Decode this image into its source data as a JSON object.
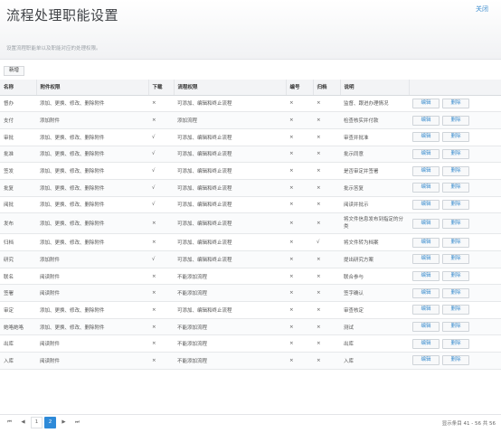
{
  "header": {
    "title": "流程处理职能设置",
    "close_label": "关闭",
    "subtitle": "设置流程职能单以及职能对应的处理权限。"
  },
  "toolbar": {
    "new_label": "新增"
  },
  "table": {
    "columns": [
      "名称",
      "附件权限",
      "下载",
      "流程权限",
      "编号",
      "归档",
      "说明",
      ""
    ],
    "rows": [
      {
        "name": "督办",
        "attach": "添加、更换、修改、删除附件",
        "download": "×",
        "flow": "可添加、编辑和终止流程",
        "number": "×",
        "archive": "×",
        "desc": "监督、跟进办理情况"
      },
      {
        "name": "支付",
        "attach": "添加附件",
        "download": "×",
        "flow": "添加流程",
        "number": "×",
        "archive": "×",
        "desc": "检查核实并付款"
      },
      {
        "name": "审批",
        "attach": "添加、更换、修改、删除附件",
        "download": "√",
        "flow": "可添加、编辑和终止流程",
        "number": "×",
        "archive": "×",
        "desc": "审查并批准"
      },
      {
        "name": "批准",
        "attach": "添加、更换、修改、删除附件",
        "download": "√",
        "flow": "可添加、编辑和终止流程",
        "number": "×",
        "archive": "×",
        "desc": "批示同意"
      },
      {
        "name": "签发",
        "attach": "添加、更换、修改、删除附件",
        "download": "√",
        "flow": "可添加、编辑和终止流程",
        "number": "×",
        "archive": "×",
        "desc": "是否审定并签署"
      },
      {
        "name": "批复",
        "attach": "添加、更换、修改、删除附件",
        "download": "√",
        "flow": "可添加、编辑和终止流程",
        "number": "×",
        "archive": "×",
        "desc": "批示答复"
      },
      {
        "name": "阅批",
        "attach": "添加、更换、修改、删除附件",
        "download": "√",
        "flow": "可添加、编辑和终止流程",
        "number": "×",
        "archive": "×",
        "desc": "阅读并批示"
      },
      {
        "name": "发布",
        "attach": "添加、更换、修改、删除附件",
        "download": "×",
        "flow": "可添加、编辑和终止流程",
        "number": "×",
        "archive": "×",
        "desc": "将文件信息发布到指定的分类",
        "tall": true
      },
      {
        "name": "归档",
        "attach": "添加、更换、修改、删除附件",
        "download": "×",
        "flow": "可添加、编辑和终止流程",
        "number": "×",
        "archive": "√",
        "desc": "将文件转为档案"
      },
      {
        "name": "研究",
        "attach": "添加附件",
        "download": "√",
        "flow": "可添加、编辑和终止流程",
        "number": "×",
        "archive": "×",
        "desc": "提出研究方案"
      },
      {
        "name": "联名",
        "attach": "阅读附件",
        "download": "×",
        "flow": "不能添加流程",
        "number": "×",
        "archive": "×",
        "desc": "联合参与"
      },
      {
        "name": "签署",
        "attach": "阅读附件",
        "download": "×",
        "flow": "不能添加流程",
        "number": "×",
        "archive": "×",
        "desc": "签字确认"
      },
      {
        "name": "审定",
        "attach": "添加、更换、修改、删除附件",
        "download": "×",
        "flow": "可添加、编辑和终止流程",
        "number": "×",
        "archive": "×",
        "desc": "审查核定"
      },
      {
        "name": "她咯她咯",
        "attach": "添加、更换、修改、删除附件",
        "download": "×",
        "flow": "不能添加流程",
        "number": "×",
        "archive": "×",
        "desc": "测试"
      },
      {
        "name": "出库",
        "attach": "阅读附件",
        "download": "×",
        "flow": "不能添加流程",
        "number": "×",
        "archive": "×",
        "desc": "出库"
      },
      {
        "name": "入库",
        "attach": "阅读附件",
        "download": "×",
        "flow": "不能添加流程",
        "number": "×",
        "archive": "×",
        "desc": "入库"
      }
    ],
    "edit_label": "编辑",
    "delete_label": "删除"
  },
  "pagination": {
    "first": "⏮",
    "prev": "◀",
    "pages": [
      "1",
      "2"
    ],
    "current_page": "2",
    "next": "▶",
    "last": "⏭",
    "info": "显示条目 41 - 56 共 56"
  },
  "colors": {
    "accent": "#2e8ad8",
    "link": "#3c8dce"
  }
}
